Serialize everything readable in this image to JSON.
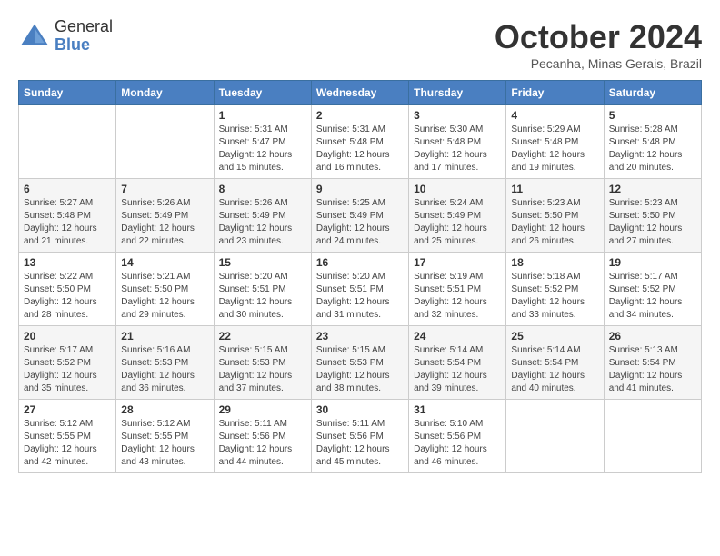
{
  "header": {
    "logo_general": "General",
    "logo_blue": "Blue",
    "month": "October 2024",
    "location": "Pecanha, Minas Gerais, Brazil"
  },
  "weekdays": [
    "Sunday",
    "Monday",
    "Tuesday",
    "Wednesday",
    "Thursday",
    "Friday",
    "Saturday"
  ],
  "weeks": [
    [
      {
        "day": "",
        "info": ""
      },
      {
        "day": "",
        "info": ""
      },
      {
        "day": "1",
        "info": "Sunrise: 5:31 AM\nSunset: 5:47 PM\nDaylight: 12 hours and 15 minutes."
      },
      {
        "day": "2",
        "info": "Sunrise: 5:31 AM\nSunset: 5:48 PM\nDaylight: 12 hours and 16 minutes."
      },
      {
        "day": "3",
        "info": "Sunrise: 5:30 AM\nSunset: 5:48 PM\nDaylight: 12 hours and 17 minutes."
      },
      {
        "day": "4",
        "info": "Sunrise: 5:29 AM\nSunset: 5:48 PM\nDaylight: 12 hours and 19 minutes."
      },
      {
        "day": "5",
        "info": "Sunrise: 5:28 AM\nSunset: 5:48 PM\nDaylight: 12 hours and 20 minutes."
      }
    ],
    [
      {
        "day": "6",
        "info": "Sunrise: 5:27 AM\nSunset: 5:48 PM\nDaylight: 12 hours and 21 minutes."
      },
      {
        "day": "7",
        "info": "Sunrise: 5:26 AM\nSunset: 5:49 PM\nDaylight: 12 hours and 22 minutes."
      },
      {
        "day": "8",
        "info": "Sunrise: 5:26 AM\nSunset: 5:49 PM\nDaylight: 12 hours and 23 minutes."
      },
      {
        "day": "9",
        "info": "Sunrise: 5:25 AM\nSunset: 5:49 PM\nDaylight: 12 hours and 24 minutes."
      },
      {
        "day": "10",
        "info": "Sunrise: 5:24 AM\nSunset: 5:49 PM\nDaylight: 12 hours and 25 minutes."
      },
      {
        "day": "11",
        "info": "Sunrise: 5:23 AM\nSunset: 5:50 PM\nDaylight: 12 hours and 26 minutes."
      },
      {
        "day": "12",
        "info": "Sunrise: 5:23 AM\nSunset: 5:50 PM\nDaylight: 12 hours and 27 minutes."
      }
    ],
    [
      {
        "day": "13",
        "info": "Sunrise: 5:22 AM\nSunset: 5:50 PM\nDaylight: 12 hours and 28 minutes."
      },
      {
        "day": "14",
        "info": "Sunrise: 5:21 AM\nSunset: 5:50 PM\nDaylight: 12 hours and 29 minutes."
      },
      {
        "day": "15",
        "info": "Sunrise: 5:20 AM\nSunset: 5:51 PM\nDaylight: 12 hours and 30 minutes."
      },
      {
        "day": "16",
        "info": "Sunrise: 5:20 AM\nSunset: 5:51 PM\nDaylight: 12 hours and 31 minutes."
      },
      {
        "day": "17",
        "info": "Sunrise: 5:19 AM\nSunset: 5:51 PM\nDaylight: 12 hours and 32 minutes."
      },
      {
        "day": "18",
        "info": "Sunrise: 5:18 AM\nSunset: 5:52 PM\nDaylight: 12 hours and 33 minutes."
      },
      {
        "day": "19",
        "info": "Sunrise: 5:17 AM\nSunset: 5:52 PM\nDaylight: 12 hours and 34 minutes."
      }
    ],
    [
      {
        "day": "20",
        "info": "Sunrise: 5:17 AM\nSunset: 5:52 PM\nDaylight: 12 hours and 35 minutes."
      },
      {
        "day": "21",
        "info": "Sunrise: 5:16 AM\nSunset: 5:53 PM\nDaylight: 12 hours and 36 minutes."
      },
      {
        "day": "22",
        "info": "Sunrise: 5:15 AM\nSunset: 5:53 PM\nDaylight: 12 hours and 37 minutes."
      },
      {
        "day": "23",
        "info": "Sunrise: 5:15 AM\nSunset: 5:53 PM\nDaylight: 12 hours and 38 minutes."
      },
      {
        "day": "24",
        "info": "Sunrise: 5:14 AM\nSunset: 5:54 PM\nDaylight: 12 hours and 39 minutes."
      },
      {
        "day": "25",
        "info": "Sunrise: 5:14 AM\nSunset: 5:54 PM\nDaylight: 12 hours and 40 minutes."
      },
      {
        "day": "26",
        "info": "Sunrise: 5:13 AM\nSunset: 5:54 PM\nDaylight: 12 hours and 41 minutes."
      }
    ],
    [
      {
        "day": "27",
        "info": "Sunrise: 5:12 AM\nSunset: 5:55 PM\nDaylight: 12 hours and 42 minutes."
      },
      {
        "day": "28",
        "info": "Sunrise: 5:12 AM\nSunset: 5:55 PM\nDaylight: 12 hours and 43 minutes."
      },
      {
        "day": "29",
        "info": "Sunrise: 5:11 AM\nSunset: 5:56 PM\nDaylight: 12 hours and 44 minutes."
      },
      {
        "day": "30",
        "info": "Sunrise: 5:11 AM\nSunset: 5:56 PM\nDaylight: 12 hours and 45 minutes."
      },
      {
        "day": "31",
        "info": "Sunrise: 5:10 AM\nSunset: 5:56 PM\nDaylight: 12 hours and 46 minutes."
      },
      {
        "day": "",
        "info": ""
      },
      {
        "day": "",
        "info": ""
      }
    ]
  ]
}
